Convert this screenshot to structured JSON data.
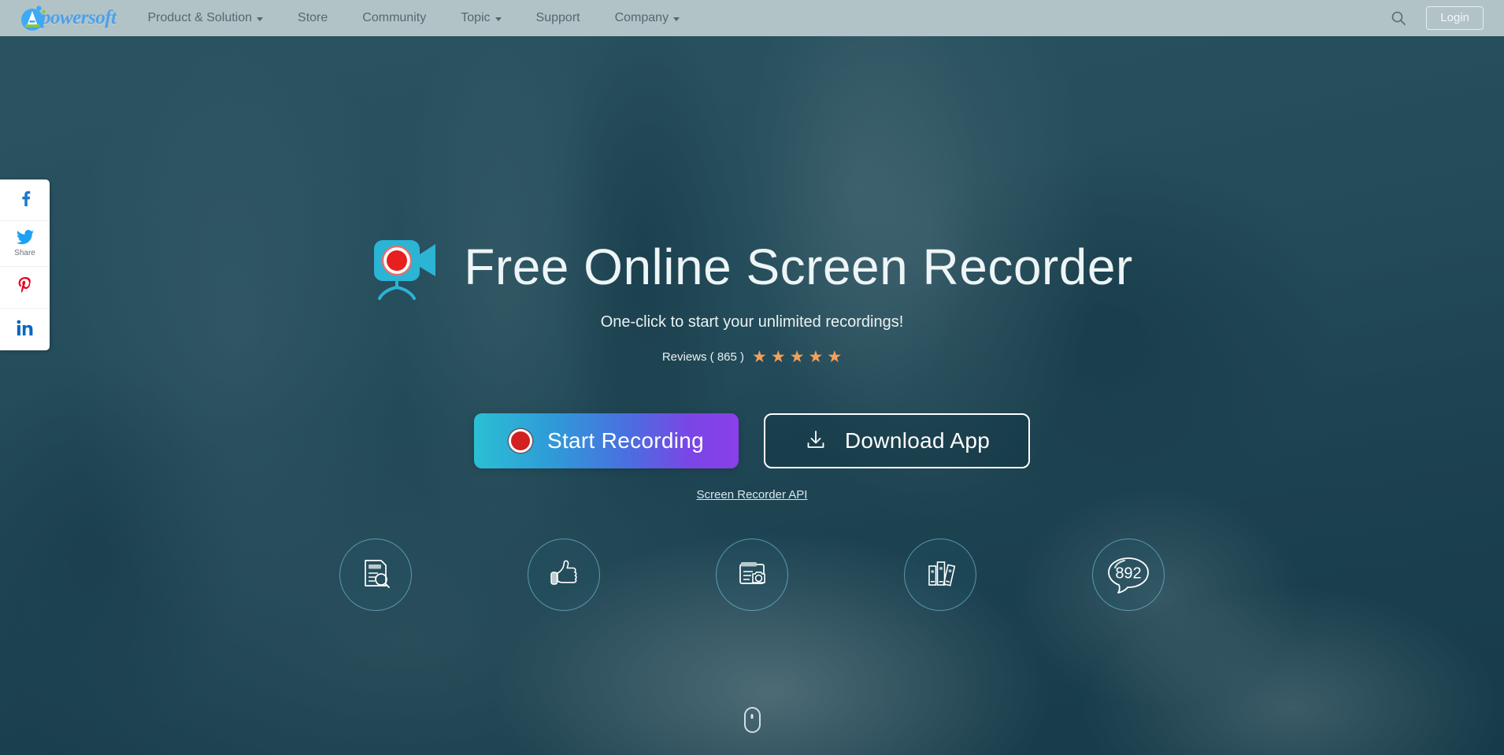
{
  "header": {
    "logo": {
      "name": "Apowersoft",
      "wordmark": "powersoft",
      "mark_letter": "A"
    },
    "nav": [
      {
        "label": "Product & Solution",
        "has_caret": true
      },
      {
        "label": "Store",
        "has_caret": false
      },
      {
        "label": "Community",
        "has_caret": false
      },
      {
        "label": "Topic",
        "has_caret": true
      },
      {
        "label": "Support",
        "has_caret": false
      },
      {
        "label": "Company",
        "has_caret": true
      }
    ],
    "search_icon": "search-icon",
    "login_label": "Login",
    "background_color": "#b2c3c8"
  },
  "social_sidebar": [
    {
      "network": "facebook",
      "icon": "facebook-icon",
      "glyph": "f",
      "color": "#1b78d0",
      "label": ""
    },
    {
      "network": "twitter",
      "icon": "twitter-icon",
      "glyph": "",
      "color": "#1da1f2",
      "label": "Share"
    },
    {
      "network": "pinterest",
      "icon": "pinterest-icon",
      "glyph": "P",
      "color": "#e60023",
      "label": ""
    },
    {
      "network": "linkedin",
      "icon": "linkedin-icon",
      "glyph": "in",
      "color": "#0a66c2",
      "label": ""
    }
  ],
  "hero": {
    "icon": "video-camera-record-icon",
    "title": "Free Online Screen Recorder",
    "subtitle": "One-click to start your unlimited recordings!",
    "reviews_label": "Reviews ( 865 )",
    "reviews_count": 865,
    "stars": 5,
    "star_color": "#f5a05a",
    "primary_button": {
      "label": "Start Recording",
      "icon": "record-dot-icon",
      "gradient_from": "#2bbfd4",
      "gradient_to": "#8a3fe9"
    },
    "secondary_button": {
      "label": "Download App",
      "icon": "download-icon"
    },
    "api_link": "Screen Recorder API",
    "features": [
      {
        "icon": "document-search-icon",
        "name": "document-search"
      },
      {
        "icon": "thumbs-up-icon",
        "name": "thumbs-up"
      },
      {
        "icon": "browser-screenshot-icon",
        "name": "browser-screenshot"
      },
      {
        "icon": "books-icon",
        "name": "books"
      },
      {
        "icon": "speech-bubble-icon",
        "name": "comments",
        "count": "892"
      }
    ],
    "scroll_indicator": "scroll-down-mouse-icon"
  }
}
